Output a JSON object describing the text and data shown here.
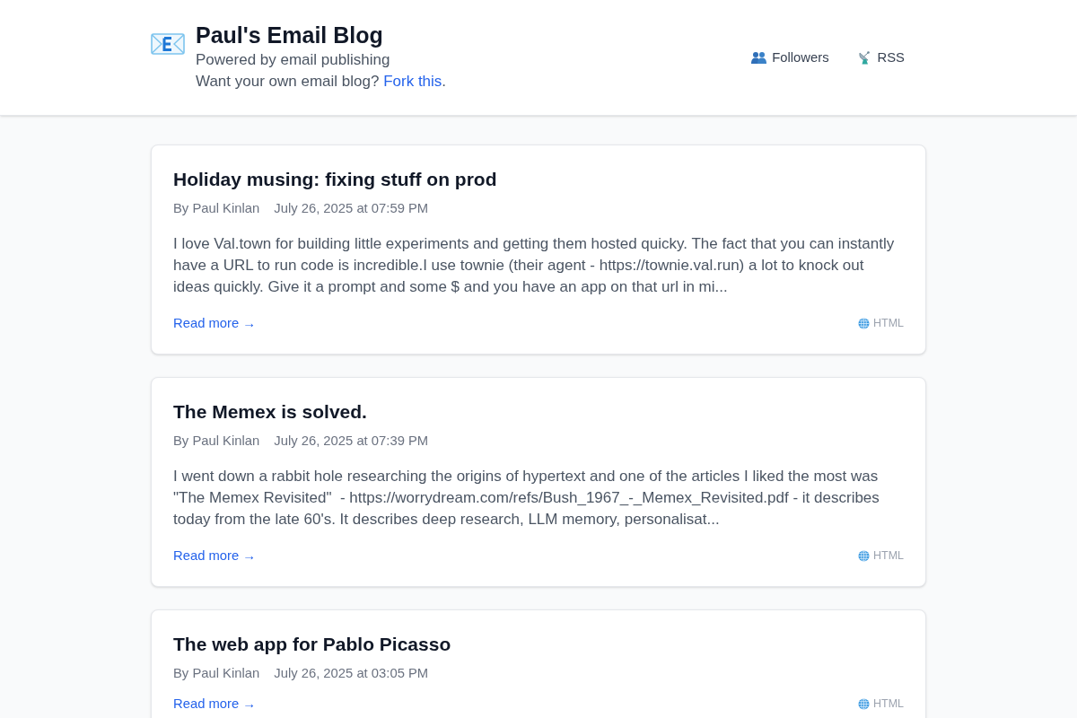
{
  "blog": {
    "title": "Paul's Email Blog",
    "tagline": "Powered by email publishing",
    "cta_text": "Want your own email blog?",
    "cta_link": "Fork this",
    "cta_end": "."
  },
  "nav": [
    {
      "label": "Followers",
      "kind": "followers"
    },
    {
      "label": "RSS",
      "kind": "rss"
    }
  ],
  "posts": [
    {
      "title": "Holiday musing: fixing stuff on prod",
      "author": "By Paul Kinlan",
      "date": "July 26, 2025 at 07:59 PM",
      "excerpt": "I love Val.town for building little experiments and getting them hosted quicky. The fact that you can instantly have a URL to run code is incredible.I use townie (their agent - https://townie.val.run) a lot to knock out ideas quickly. Give it a prompt and some $ and you have an app on that url in mi...",
      "link": "Read more →",
      "format": "HTML"
    },
    {
      "title": "The Memex is solved.",
      "author": "By Paul Kinlan",
      "date": "July 26, 2025 at 07:39 PM",
      "excerpt": "I went down a rabbit hole researching the origins of hypertext and one of the articles I liked the most was \"The Memex Revisited\"  - https://worrydream.com/refs/Bush_1967_-_Memex_Revisited.pdf - it describes today from the late 60's. It describes deep research, LLM memory, personalisat...",
      "link": "Read more →",
      "format": "HTML"
    },
    {
      "title": "The web app for Pablo Picasso",
      "author": "By Paul Kinlan",
      "date": "July 26, 2025 at 03:05 PM",
      "link": "Read more →",
      "format": "HTML"
    }
  ]
}
